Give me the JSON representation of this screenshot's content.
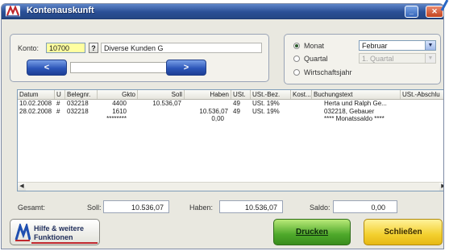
{
  "window": {
    "title": "Kontenauskunft"
  },
  "konto": {
    "label": "Konto:",
    "value": "10700",
    "lookup_label": "?",
    "description": "Diverse Kunden G",
    "prev_label": "<",
    "next_label": ">"
  },
  "period": {
    "monat_label": "Monat",
    "quartal_label": "Quartal",
    "wirtschaftsjahr_label": "Wirtschaftsjahr",
    "selected": "Monat",
    "monat_value": "Februar",
    "quartal_value": "1. Quartal"
  },
  "grid": {
    "columns": [
      "Datum",
      "U",
      "Belegnr.",
      "Gkto",
      "Soll",
      "Haben",
      "USt.",
      "USt.-Bez.",
      "Kost...",
      "Buchungstext",
      "USt.-Abschlu"
    ],
    "rows": [
      {
        "datum": "10.02.2008",
        "u": "#",
        "belegnr": "032218",
        "gkto": "4400",
        "soll": "10.536,07",
        "haben": "",
        "ust": "49",
        "ustbez": "USt. 19%",
        "kost": "",
        "text": "Herta und Ralph Ge..."
      },
      {
        "datum": "28.02.2008",
        "u": "#",
        "belegnr": "032218",
        "gkto": "1610",
        "soll": "",
        "haben": "10.536,07",
        "ust": "49",
        "ustbez": "USt. 19%",
        "kost": "",
        "text": "032218, Gebauer"
      },
      {
        "datum": "",
        "u": "",
        "belegnr": "",
        "gkto": "********",
        "soll": "",
        "haben": "0,00",
        "ust": "",
        "ustbez": "",
        "kost": "",
        "text": "**** Monatssaldo ****"
      }
    ]
  },
  "totals": {
    "gesamt_label": "Gesamt:",
    "soll_label": "Soll:",
    "soll_value": "10.536,07",
    "haben_label": "Haben:",
    "haben_value": "10.536,07",
    "saldo_label": "Saldo:",
    "saldo_value": "0,00"
  },
  "buttons": {
    "hilfe_line1": "Hilfe & weitere",
    "hilfe_line2": "Funktionen",
    "drucken": "Drucken",
    "schliessen": "Schließen"
  },
  "colors": {
    "titlebar": "#2a4f96",
    "konto_field": "#ffffa0",
    "drucken": "#4ea82a",
    "schliessen": "#f3d02f"
  }
}
